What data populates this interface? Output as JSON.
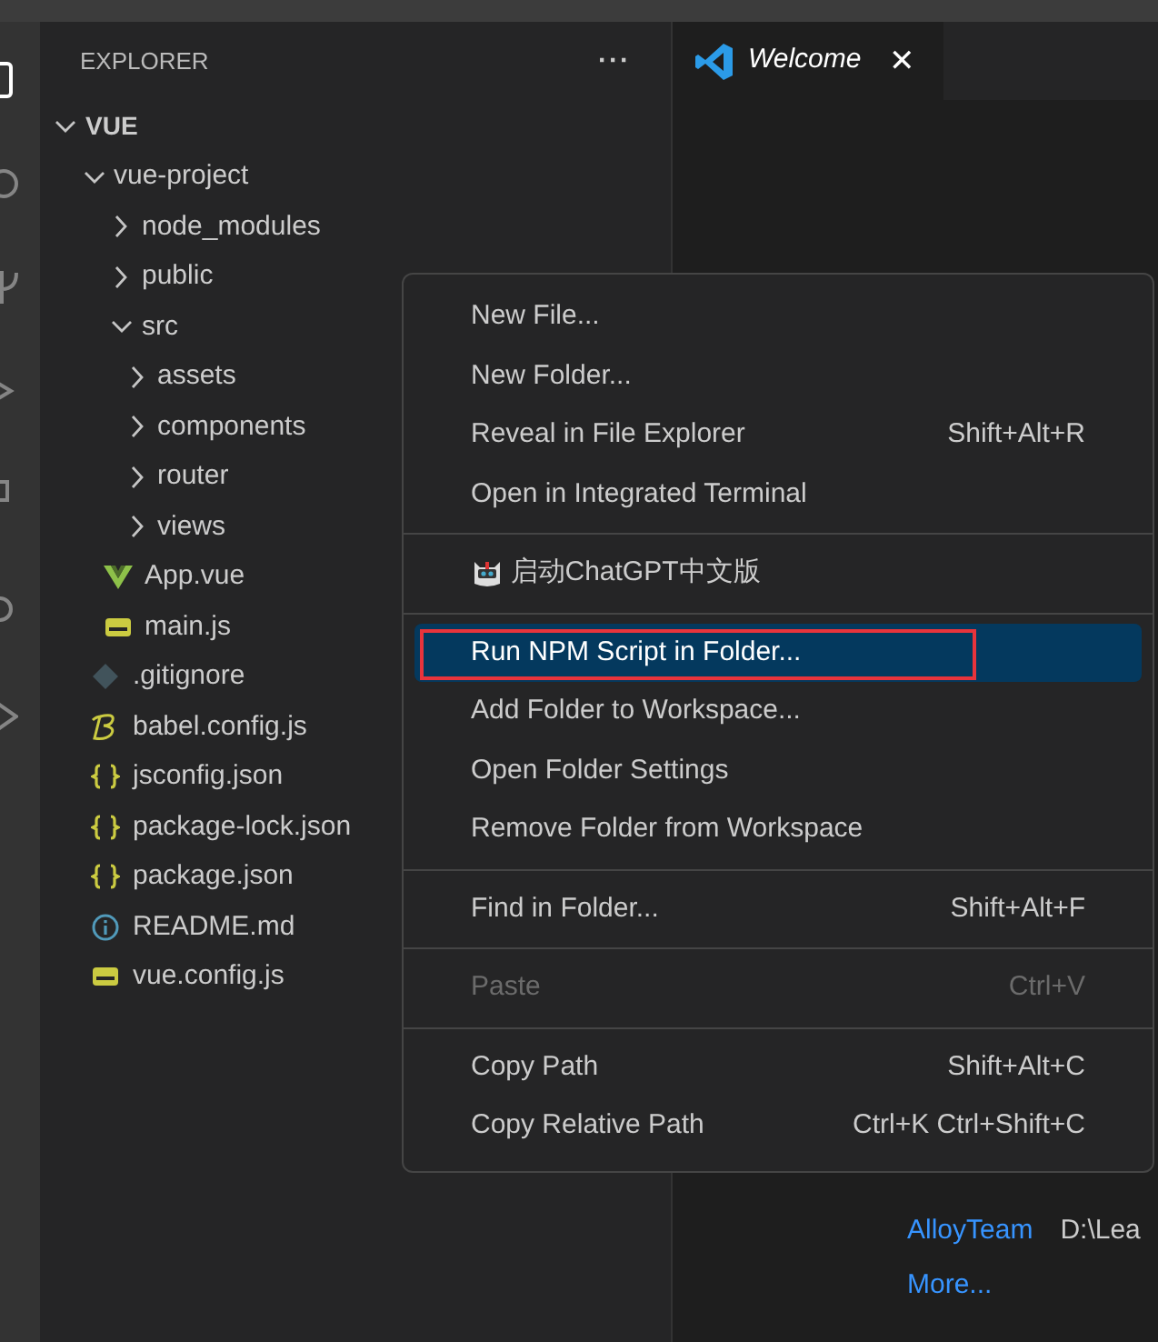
{
  "sidebar": {
    "title": "EXPLORER",
    "more": "···",
    "tree": [
      {
        "label": "VUE",
        "kind": "root",
        "expanded": true,
        "children": [
          {
            "label": "vue-project",
            "kind": "folder",
            "expanded": true,
            "children": [
              {
                "label": "node_modules",
                "kind": "folder",
                "expanded": false
              },
              {
                "label": "public",
                "kind": "folder",
                "expanded": false
              },
              {
                "label": "src",
                "kind": "folder",
                "expanded": true,
                "children": [
                  {
                    "label": "assets",
                    "kind": "folder",
                    "expanded": false
                  },
                  {
                    "label": "components",
                    "kind": "folder",
                    "expanded": false
                  },
                  {
                    "label": "router",
                    "kind": "folder",
                    "expanded": false
                  },
                  {
                    "label": "views",
                    "kind": "folder",
                    "expanded": false
                  },
                  {
                    "label": "App.vue",
                    "kind": "vue"
                  },
                  {
                    "label": "main.js",
                    "kind": "js"
                  }
                ]
              },
              {
                "label": ".gitignore",
                "kind": "git"
              },
              {
                "label": "babel.config.js",
                "kind": "babel"
              },
              {
                "label": "jsconfig.json",
                "kind": "json"
              },
              {
                "label": "package-lock.json",
                "kind": "json"
              },
              {
                "label": "package.json",
                "kind": "json"
              },
              {
                "label": "README.md",
                "kind": "info"
              },
              {
                "label": "vue.config.js",
                "kind": "js"
              }
            ]
          }
        ]
      }
    ]
  },
  "tabs": [
    {
      "label": "Welcome",
      "selected": true,
      "close": "✕"
    }
  ],
  "editor": {
    "recent": [
      {
        "name": "AlloyTeam",
        "path": "D:\\Lea"
      }
    ],
    "more": "More..."
  },
  "context_menu": [
    [
      {
        "label": "New File...",
        "kind": "command",
        "selected": false,
        "disabled": false
      },
      {
        "label": "New Folder...",
        "kind": "command",
        "selected": false,
        "disabled": false
      },
      {
        "label": "Reveal in File Explorer",
        "shortcut": "Shift+Alt+R",
        "kind": "command",
        "selected": false,
        "disabled": false
      },
      {
        "label": "Open in Integrated Terminal",
        "kind": "command",
        "selected": false,
        "disabled": false
      }
    ],
    [
      {
        "label": "启动ChatGPT中文版",
        "kind": "extension",
        "selected": false,
        "disabled": false
      }
    ],
    [
      {
        "label": "Run NPM Script in Folder...",
        "kind": "command",
        "selected": true,
        "disabled": false,
        "outlined": true
      },
      {
        "label": "Add Folder to Workspace...",
        "kind": "command",
        "selected": false,
        "disabled": false
      },
      {
        "label": "Open Folder Settings",
        "kind": "command",
        "selected": false,
        "disabled": false
      },
      {
        "label": "Remove Folder from Workspace",
        "kind": "command",
        "selected": false,
        "disabled": false
      }
    ],
    [
      {
        "label": "Find in Folder...",
        "shortcut": "Shift+Alt+F",
        "kind": "command",
        "selected": false,
        "disabled": false
      }
    ],
    [
      {
        "label": "Paste",
        "shortcut": "Ctrl+V",
        "kind": "command",
        "selected": false,
        "disabled": true
      }
    ],
    [
      {
        "label": "Copy Path",
        "shortcut": "Shift+Alt+C",
        "kind": "command",
        "selected": false,
        "disabled": false
      },
      {
        "label": "Copy Relative Path",
        "shortcut": "Ctrl+K Ctrl+Shift+C",
        "kind": "command",
        "selected": false,
        "disabled": false
      }
    ]
  ]
}
